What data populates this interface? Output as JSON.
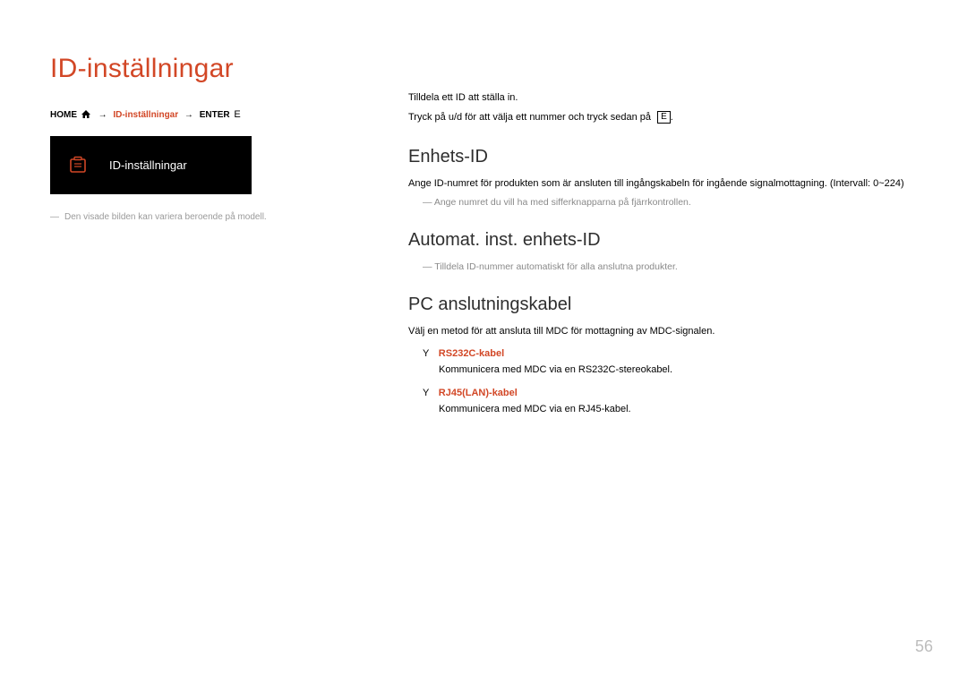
{
  "page_title": "ID-inställningar",
  "breadcrumb": {
    "home": "HOME",
    "current": "ID-inställningar",
    "enter": "ENTER"
  },
  "thumbnail": {
    "label": "ID-inställningar"
  },
  "disclaimer": "Den visade bilden kan variera beroende på modell.",
  "intro": {
    "line1": "Tilldela ett ID att ställa in.",
    "line2_pre": "Tryck på u/d för att välja ett nummer och tryck sedan på ",
    "enter_glyph": "E"
  },
  "sections": {
    "enhets_id": {
      "heading": "Enhets-ID",
      "text": "Ange ID-numret för produkten som är ansluten till ingångskabeln för ingående signalmottagning. (Intervall: 0~224)",
      "note": "Ange numret du vill ha med sifferknapparna på fjärrkontrollen."
    },
    "auto_id": {
      "heading": "Automat. inst. enhets-ID",
      "note": "Tilldela ID-nummer automatiskt för alla anslutna produkter."
    },
    "pc_cable": {
      "heading": "PC anslutningskabel",
      "text": "Välj en metod för att ansluta till MDC för mottagning av MDC-signalen.",
      "options": [
        {
          "name": "RS232C-kabel",
          "desc": "Kommunicera med MDC via en RS232C-stereokabel."
        },
        {
          "name": "RJ45(LAN)-kabel",
          "desc": "Kommunicera med MDC via en RJ45-kabel."
        }
      ]
    }
  },
  "option_bullet": "Y",
  "page_number": "56"
}
